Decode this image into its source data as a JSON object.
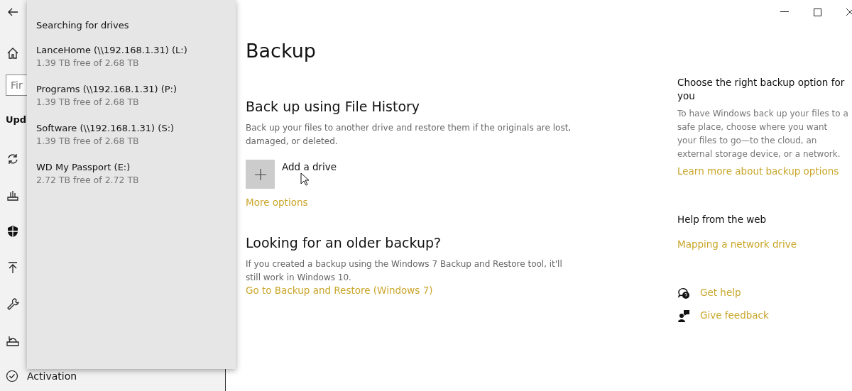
{
  "sidebar": {
    "search": {
      "placeholder": "Fir"
    },
    "section_title": "Upd",
    "activation": "Activation"
  },
  "drive_flyout": {
    "title": "Searching for drives",
    "drives": [
      {
        "name": "LanceHome (\\\\192.168.1.31) (L:)",
        "space": "1.39 TB free of 2.68 TB"
      },
      {
        "name": "Programs (\\\\192.168.1.31) (P:)",
        "space": "1.39 TB free of 2.68 TB"
      },
      {
        "name": "Software (\\\\192.168.1.31) (S:)",
        "space": "1.39 TB free of 2.68 TB"
      },
      {
        "name": "WD My Passport (E:)",
        "space": "2.72 TB free of 2.72 TB"
      }
    ]
  },
  "main": {
    "title": "Backup",
    "file_history": {
      "heading": "Back up using File History",
      "description": "Back up your files to another drive and restore them if the originals are lost, damaged, or deleted.",
      "add_drive": "Add a drive",
      "more_options": "More options"
    },
    "older_backup": {
      "heading": "Looking for an older backup?",
      "description": "If you created a backup using the Windows 7 Backup and Restore tool, it'll still work in Windows 10.",
      "link": "Go to Backup and Restore (Windows 7)"
    }
  },
  "aside": {
    "heading": "Choose the right backup option for you",
    "description": "To have Windows back up your files to a safe place, choose where you want your files to go—to the cloud, an external storage device, or a network.",
    "link": "Learn more about backup options",
    "help_heading": "Help from the web",
    "help_link": "Mapping a network drive",
    "actions": [
      {
        "kind": "help",
        "label": "Get help"
      },
      {
        "kind": "feedback",
        "label": "Give feedback"
      }
    ]
  }
}
